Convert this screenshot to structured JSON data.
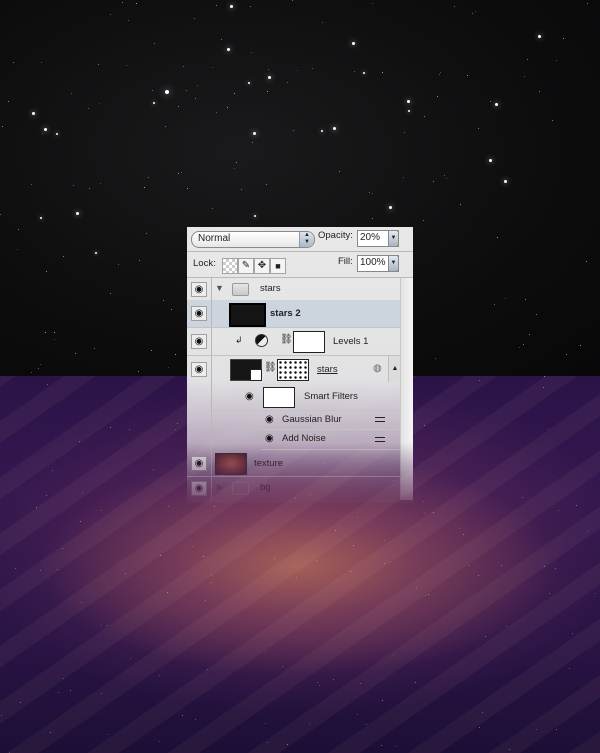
{
  "canvas": {
    "upper_region": "starfield",
    "lower_region": "nebula",
    "colors": {
      "sky": "#0d0d0e",
      "nebula_dark": "#2b1348",
      "nebula_glow": "#b06856"
    }
  },
  "layers_panel": {
    "blend_mode": "Normal",
    "opacity_label": "Opacity:",
    "opacity_value": "20%",
    "lock_label": "Lock:",
    "fill_label": "Fill:",
    "fill_value": "100%",
    "lock_icons": [
      "lock-transparent-pixels-icon",
      "lock-image-pixels-icon",
      "lock-position-icon",
      "lock-all-icon"
    ],
    "layers": [
      {
        "name": "stars",
        "type": "group",
        "expanded": true,
        "visible": true
      },
      {
        "name": "stars 2",
        "type": "layer",
        "selected": true,
        "visible": true
      },
      {
        "name": "Levels 1",
        "type": "adjustment",
        "clipped": true,
        "visible": true
      },
      {
        "name": "stars",
        "type": "smart-object",
        "visible": true
      },
      {
        "name": "Smart Filters",
        "type": "smart-filters",
        "visible": true
      },
      {
        "name": "Gaussian Blur",
        "type": "filter",
        "visible": true
      },
      {
        "name": "Add Noise",
        "type": "filter",
        "visible": true
      },
      {
        "name": "texture",
        "type": "layer",
        "visible": true
      },
      {
        "name": "bg",
        "type": "group",
        "expanded": false,
        "visible": true
      }
    ],
    "selection_color": "#ccd4de"
  }
}
